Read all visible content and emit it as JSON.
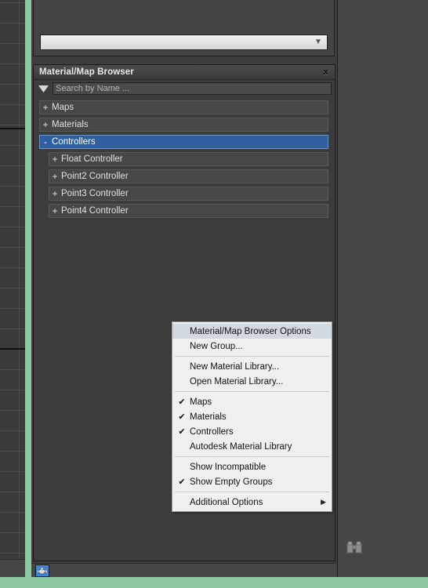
{
  "app": {
    "viewport_grid_color": "#4c4c4c",
    "accent_green": "#8cc9a0",
    "selection_blue": "#2f5f9e"
  },
  "top_rollout": {
    "combo": {
      "value": "",
      "arrow_icon": "chevron-down-icon"
    }
  },
  "browser": {
    "title": "Material/Map Browser",
    "close_label": "x",
    "search": {
      "placeholder": "Search by Name ...",
      "value": "",
      "filter_icon": "filter-triangle-icon"
    },
    "tree": [
      {
        "label": "Maps",
        "toggle": "+",
        "level": 0,
        "selected": false
      },
      {
        "label": "Materials",
        "toggle": "+",
        "level": 0,
        "selected": false
      },
      {
        "label": "Controllers",
        "toggle": "-",
        "level": 0,
        "selected": true
      },
      {
        "label": "Float Controller",
        "toggle": "+",
        "level": 1,
        "selected": false
      },
      {
        "label": "Point2 Controller",
        "toggle": "+",
        "level": 1,
        "selected": false
      },
      {
        "label": "Point3 Controller",
        "toggle": "+",
        "level": 1,
        "selected": false
      },
      {
        "label": "Point4 Controller",
        "toggle": "+",
        "level": 1,
        "selected": false
      }
    ]
  },
  "context_menu": {
    "items": [
      {
        "label": "Material/Map Browser Options",
        "checked": false,
        "highlighted": true,
        "submenu": false
      },
      {
        "label": "New Group...",
        "checked": false,
        "highlighted": false,
        "submenu": false
      },
      {
        "separator": true
      },
      {
        "label": "New Material Library...",
        "checked": false,
        "highlighted": false,
        "submenu": false
      },
      {
        "label": "Open Material Library...",
        "checked": false,
        "highlighted": false,
        "submenu": false
      },
      {
        "separator": true
      },
      {
        "label": "Maps",
        "checked": true,
        "highlighted": false,
        "submenu": false
      },
      {
        "label": "Materials",
        "checked": true,
        "highlighted": false,
        "submenu": false
      },
      {
        "label": "Controllers",
        "checked": true,
        "highlighted": false,
        "submenu": false
      },
      {
        "label": "Autodesk Material Library",
        "checked": false,
        "highlighted": false,
        "submenu": false
      },
      {
        "separator": true
      },
      {
        "label": "Show Incompatible",
        "checked": false,
        "highlighted": false,
        "submenu": false
      },
      {
        "label": "Show Empty Groups",
        "checked": true,
        "highlighted": false,
        "submenu": false
      },
      {
        "separator": true
      },
      {
        "label": "Additional Options",
        "checked": false,
        "highlighted": false,
        "submenu": true
      }
    ],
    "check_glyph": "✔",
    "submenu_glyph": "▶"
  },
  "toolbar": {
    "sample_object_icon": "teapot-icon"
  },
  "right_panel": {
    "icon": "binoculars-icon"
  }
}
